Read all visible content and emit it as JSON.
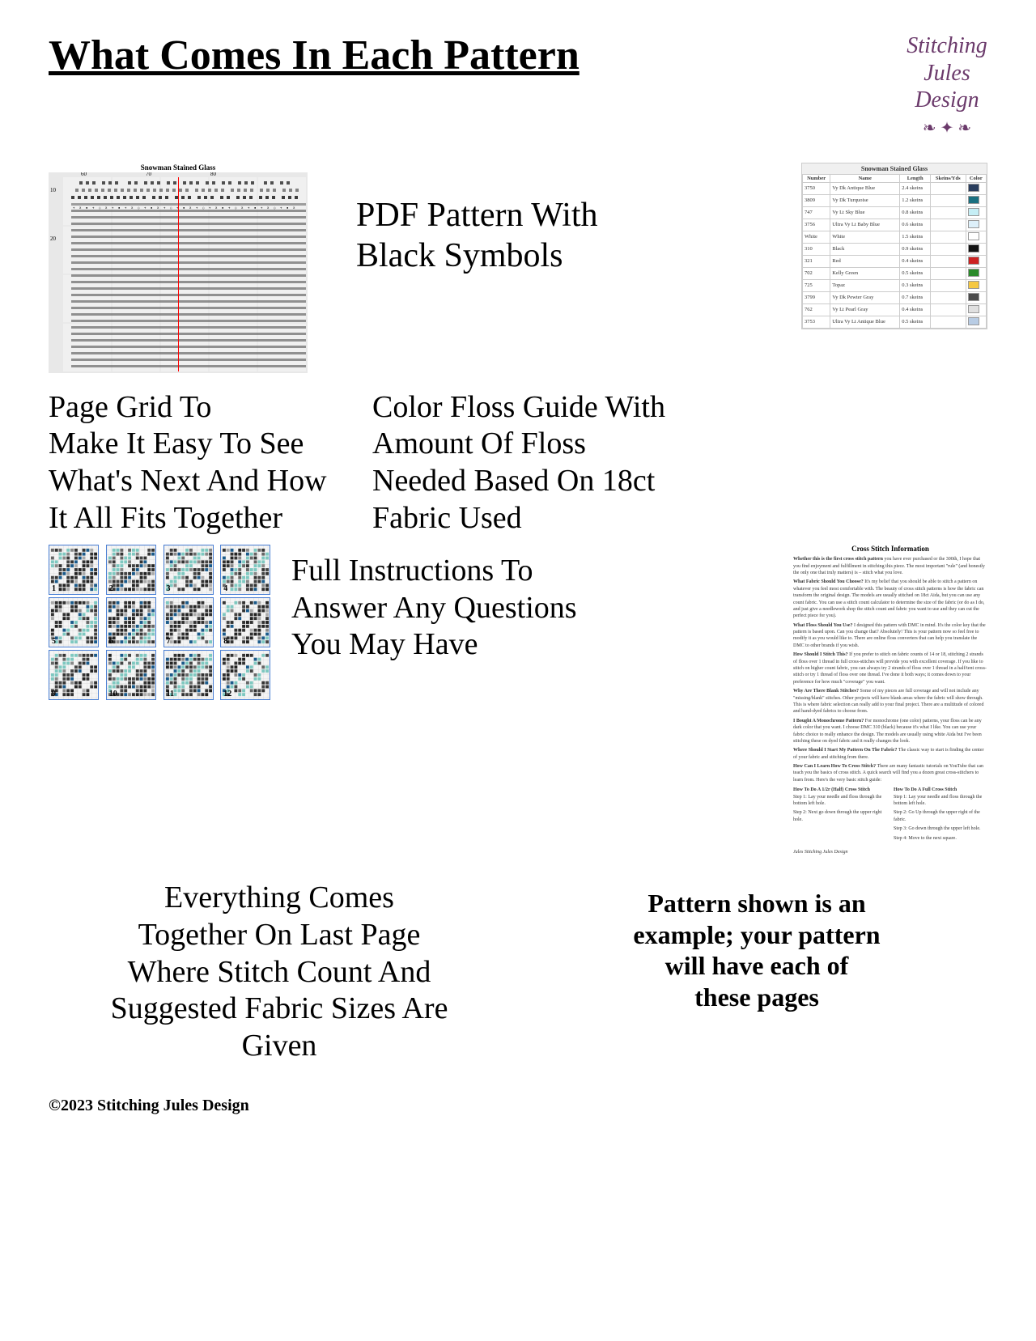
{
  "header": {
    "title": "What Comes In Each Pattern",
    "logo_line1": "Stitching",
    "logo_line2": "Jules",
    "logo_line3": "Design"
  },
  "section1": {
    "pattern_title": "Snowman Stained Glass",
    "pdf_line1": "PDF Pattern With",
    "pdf_line2": "Black Symbols",
    "pdf_line3": "",
    "floss_table_title": "Snowman Stained Glass",
    "floss_rows": [
      {
        "number": "3750",
        "name": "Vy Dk Antique Blue",
        "length": "2.4 skeins",
        "color": "#2a3e5e"
      },
      {
        "number": "3809",
        "name": "Vy Dk Turquoise",
        "length": "1.2 skeins",
        "color": "#1a7080"
      },
      {
        "number": "747",
        "name": "Vy Lt Sky Blue",
        "length": "0.8 skeins",
        "color": "#c5eef5"
      },
      {
        "number": "3756",
        "name": "Ultra Vy Lt Baby Blue",
        "length": "0.6 skeins",
        "color": "#ddf0fa"
      },
      {
        "number": "White",
        "name": "White",
        "length": "1.5 skeins",
        "color": "#ffffff"
      },
      {
        "number": "310",
        "name": "Black",
        "length": "0.9 skeins",
        "color": "#111111"
      },
      {
        "number": "321",
        "name": "Red",
        "length": "0.4 skeins",
        "color": "#cc2222"
      },
      {
        "number": "702",
        "name": "Kelly Green",
        "length": "0.5 skeins",
        "color": "#2a8a2a"
      },
      {
        "number": "725",
        "name": "Topaz",
        "length": "0.3 skeins",
        "color": "#f5c842"
      },
      {
        "number": "3799",
        "name": "Vy Dk Pewter Gray",
        "length": "0.7 skeins",
        "color": "#4a4a4a"
      },
      {
        "number": "762",
        "name": "Vy Lt Pearl Gray",
        "length": "0.4 skeins",
        "color": "#e0e0e0"
      },
      {
        "number": "3753",
        "name": "Ultra Vy Lt Antique Blue",
        "length": "0.5 skeins",
        "color": "#b8cce4"
      }
    ]
  },
  "section3": {
    "page_grid_line1": "Page Grid To",
    "page_grid_line2": "Make It Easy To See",
    "page_grid_line3": "What's Next And How",
    "page_grid_line4": "It All Fits Together",
    "page_grid_line5": "",
    "color_floss_line1": "Color Floss Guide With",
    "color_floss_line2": "Amount Of Floss",
    "color_floss_line3": "Needed Based On 18ct",
    "color_floss_line4": "Fabric Used",
    "color_floss_line5": ""
  },
  "section4": {
    "instructions_line1": "Full Instructions To",
    "instructions_line2": "Answer Any Questions",
    "instructions_line3": "You May Have",
    "instructions_line4": "",
    "cs_info_title": "Cross Stitch Information",
    "cs_paragraphs": [
      {
        "bold": "Whether this is the first cross stitch pattern",
        "text": " you have ever purchased or the 300th, I hope that you find enjoyment and fulfillment in stitching this piece. The most important \"rule\" (and honestly the only one that truly matters) is – stitch what you love."
      },
      {
        "bold": "What Fabric Should You Choose?",
        "text": " It's my belief that you should be able to stitch a pattern on whatever you feel most comfortable with. The beauty of cross stitch patterns is how the fabric can transform the original design. The models are usually stitched on 18ct Aida, but you can use any count fabric. You can use a stitch count calculator to determine the size of the fabric (or do as I do, and just give a needlework shop the stitch count and fabric you want to use and they can cut the perfect piece for you)."
      },
      {
        "bold": "What Floss Should You Use?",
        "text": " I designed this pattern with DMC in mind. It's the color key that the pattern is based upon. Can you change that? Absolutely! This is your pattern now so feel free to modify it as you would like to. There are online floss converters that can help you translate the DMC to other brands if you wish."
      },
      {
        "bold": "How Should I Stitch This?",
        "text": " If you prefer to stitch on fabric counts of 14 or 18, stitching 2 strands of floss over 1 thread in full cross-stitches will provide you with excellent coverage. If you like to stitch on higher count fabric, you can always try 2 strands of floss over 1 thread in a half/tent cross-stitch or try 1 thread of floss over one thread. I've done it both ways; it comes down to your preference for how much \"coverage\" you want."
      },
      {
        "bold": "Why Are There Blank Stitches?",
        "text": " Some of my pieces are full coverage and will not include any \"missing/blank\" stitches. Other projects will have blank areas where the fabric will show through. This is where fabric selection can really add to your final project. There are a multitude of colored and hand-dyed fabrics to choose from."
      },
      {
        "bold": "I Bought A Monochrome Pattern?",
        "text": " For monochrome (one color) patterns, your floss can be any dark color that you want. I choose DMC 310 (black) because it's what I like. You can use your fabric choice to really enhance the design. The models are usually using white Aida but I've been stitching these on dyed fabric and it really changes the look."
      },
      {
        "bold": "Where Should I Start My Pattern On The Fabric?",
        "text": " The classic way to start is finding the center of your fabric and stitching from there."
      },
      {
        "bold": "How Can I Learn How To Cross Stitch?",
        "text": " There are many fantastic tutorials on YouTube that can teach you the basics of cross stitch. A quick search will find you a dozen great cross-stitchers to learn from. Here's the very basic stitch guide:"
      }
    ],
    "how_to_title_half": "How To Do A 1/2r (Half) Cross Stitch",
    "how_to_title_full": "How To Do A Full Cross Stitch",
    "how_to_half_steps": [
      "Step 1: Lay your needle and floss through the bottom left hole.",
      "Step 2: Next go down through the upper right hole."
    ],
    "how_to_full_steps": [
      "Step 1: Lay your needle and floss through the bottom left hole.",
      "Step 2: Go Up through the upper right of the fabric.",
      "Step 3: Go down through the upper left hole.",
      "Step 4: Move to the next square."
    ],
    "signature": "Jules\nStitching Jules Design",
    "grid_pages": [
      {
        "num": 1,
        "pattern": "top-left"
      },
      {
        "num": 2,
        "pattern": "top-center-left"
      },
      {
        "num": 3,
        "pattern": "top-center-right"
      },
      {
        "num": 4,
        "pattern": "top-right"
      },
      {
        "num": 5,
        "pattern": "mid-left"
      },
      {
        "num": 6,
        "pattern": "mid-center-left"
      },
      {
        "num": 7,
        "pattern": "mid-center-right"
      },
      {
        "num": 8,
        "pattern": "mid-right"
      },
      {
        "num": 9,
        "pattern": "bottom-left"
      },
      {
        "num": 10,
        "pattern": "bottom-center-left"
      },
      {
        "num": 11,
        "pattern": "bottom-center-right"
      },
      {
        "num": 12,
        "pattern": "bottom-right"
      }
    ]
  },
  "section5": {
    "last_page_line1": "Everything Comes",
    "last_page_line2": "Together On Last Page",
    "last_page_line3": "Where Stitch Count And",
    "last_page_line4": "Suggested Fabric Sizes Are",
    "last_page_line5": "Given",
    "example_line1": "Pattern shown is an",
    "example_line2": "example; your pattern",
    "example_line3": "will have each of",
    "example_line4": "these pages",
    "example_line5": ""
  },
  "footer": {
    "copyright": "©2023 Stitching Jules Design"
  }
}
